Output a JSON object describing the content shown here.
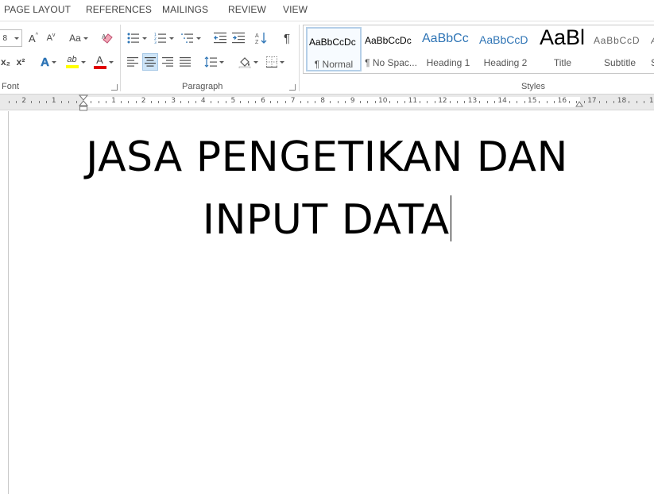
{
  "tabs": [
    "PAGE LAYOUT",
    "REFERENCES",
    "MAILINGS",
    "REVIEW",
    "VIEW"
  ],
  "groups": {
    "font": "Font",
    "paragraph": "Paragraph",
    "styles": "Styles"
  },
  "font_controls": {
    "grow": "A",
    "shrink": "A",
    "change_case": "Aa",
    "subscript": "x₂",
    "superscript": "x²",
    "text_effects": "A",
    "highlight": "ab",
    "font_color": "A"
  },
  "colors": {
    "highlight": "#ffff00",
    "font_color": "#e00000",
    "accent": "#2e75b6",
    "heading": "#2e74b5"
  },
  "styles": [
    {
      "sample": "AaBbCcDc",
      "name": "¶ Normal",
      "selected": true
    },
    {
      "sample": "AaBbCcDc",
      "name": "¶ No Spac...",
      "selected": false
    },
    {
      "sample": "AaBbCc",
      "name": "Heading 1",
      "selected": false
    },
    {
      "sample": "AaBbCcD",
      "name": "Heading 2",
      "selected": false
    },
    {
      "sample": "AaBl",
      "name": "Title",
      "selected": false
    },
    {
      "sample": "AaBbCcD",
      "name": "Subtitle",
      "selected": false
    },
    {
      "sample": "A",
      "name": "S",
      "selected": false
    }
  ],
  "ruler": {
    "left_numbers": [
      "2",
      "1"
    ],
    "right_numbers": [
      "1",
      "2",
      "3",
      "4",
      "5",
      "6",
      "7",
      "8",
      "9",
      "10",
      "11",
      "12",
      "13",
      "14",
      "15",
      "16",
      "17",
      "18",
      "1"
    ]
  },
  "document": {
    "line1": "JASA PENGETIKAN DAN",
    "line2": "INPUT DATA"
  }
}
